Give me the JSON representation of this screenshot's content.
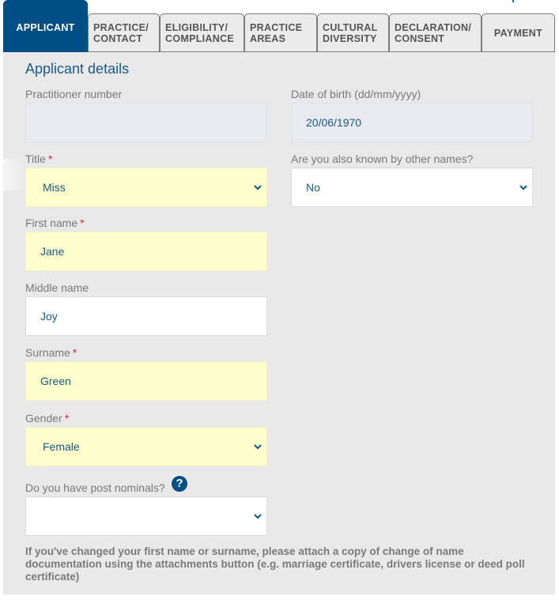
{
  "tabs": [
    {
      "line1": "APPLICANT",
      "line2": "",
      "active": true
    },
    {
      "line1": "PRACTICE/",
      "line2": "CONTACT",
      "active": false
    },
    {
      "line1": "ELIGIBILITY/",
      "line2": "COMPLIANCE",
      "active": false
    },
    {
      "line1": "PRACTICE",
      "line2": "AREAS",
      "active": false
    },
    {
      "line1": "CULTURAL",
      "line2": "DIVERSITY",
      "active": false
    },
    {
      "line1": "DECLARATION/",
      "line2": "CONSENT",
      "active": false
    },
    {
      "line1": "PAYMENT",
      "line2": "",
      "active": false
    }
  ],
  "section": {
    "title": "Applicant details"
  },
  "fields": {
    "practitioner_number": {
      "label": "Practitioner number",
      "value": ""
    },
    "date_of_birth": {
      "label": "Date of birth (dd/mm/yyyy)",
      "value": "20/06/1970"
    },
    "title": {
      "label": "Title",
      "required_mark": "*",
      "value": "Miss"
    },
    "other_names": {
      "label": "Are you also known by other names?",
      "value": "No"
    },
    "first_name": {
      "label": "First name",
      "required_mark": "*",
      "value": "Jane"
    },
    "middle_name": {
      "label": "Middle name",
      "value": "Joy"
    },
    "surname": {
      "label": "Surname",
      "required_mark": "*",
      "value": "Green"
    },
    "gender": {
      "label": "Gender",
      "required_mark": "*",
      "value": "Female"
    },
    "post_nominals": {
      "label": "Do you have post nominals?",
      "value": "",
      "help_icon": "?"
    }
  },
  "note": "If you've changed your first name or surname, please attach a copy of change of name documentation using the attachments button (e.g. marriage certificate, drivers license or deed poll certificate)",
  "colors": {
    "accent": "#004f84",
    "required_field_bg": "#ffffcc",
    "readonly_field_bg": "#e7eaee",
    "panel_bg": "#e9e9e9",
    "required_mark": "#e0203a"
  }
}
